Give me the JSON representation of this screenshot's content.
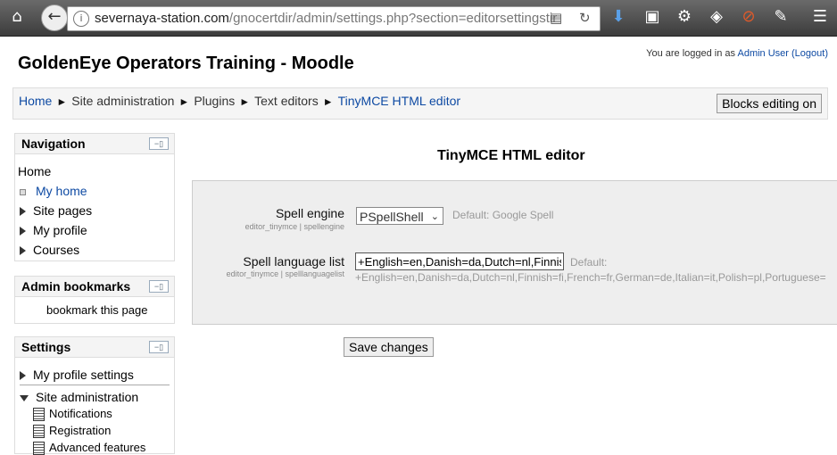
{
  "browser": {
    "url_host": "severnaya-station.com",
    "url_path": "/gnocertdir/admin/settings.php?section=editorsettingstir"
  },
  "header": {
    "site_title": "GoldenEye Operators Training - Moodle",
    "login_prefix": "You are logged in as ",
    "login_user": "Admin User",
    "logout": "(Logout)"
  },
  "breadcrumb": {
    "items": [
      "Home",
      "Site administration",
      "Plugins",
      "Text editors",
      "TinyMCE HTML editor"
    ],
    "separator": "►"
  },
  "blocks_button": "Blocks editing on",
  "navigation": {
    "title": "Navigation",
    "home": "Home",
    "items": [
      "My home",
      "Site pages",
      "My profile",
      "Courses"
    ]
  },
  "admin_bookmarks": {
    "title": "Admin bookmarks",
    "link": "bookmark this page"
  },
  "settings_block": {
    "title": "Settings",
    "items": [
      "My profile settings",
      "Site administration"
    ],
    "sub_items": [
      "Notifications",
      "Registration",
      "Advanced features"
    ]
  },
  "main": {
    "heading": "TinyMCE HTML editor",
    "spell_engine": {
      "label": "Spell engine",
      "sub": "editor_tinymce | spellengine",
      "value": "PSpellShell",
      "default": "Default: Google Spell"
    },
    "spell_language": {
      "label": "Spell language list",
      "sub": "editor_tinymce | spelllanguagelist",
      "value": "+English=en,Danish=da,Dutch=nl,Finnish=fi,French=fr,German=de,Italian=it,Polish=pl,Portuguese=pt,Spanish=es,Swedish=sv",
      "default_label": "Default:",
      "default_value": "+English=en,Danish=da,Dutch=nl,Finnish=fi,French=fr,German=de,Italian=it,Polish=pl,Portuguese="
    },
    "save": "Save changes"
  },
  "icons": [
    "home-icon",
    "back-icon",
    "info-icon",
    "rss-icon",
    "reload-icon",
    "download-icon",
    "reader-icon",
    "gear-icon",
    "pocket-icon",
    "block-icon",
    "extension-icon",
    "menu-icon"
  ]
}
